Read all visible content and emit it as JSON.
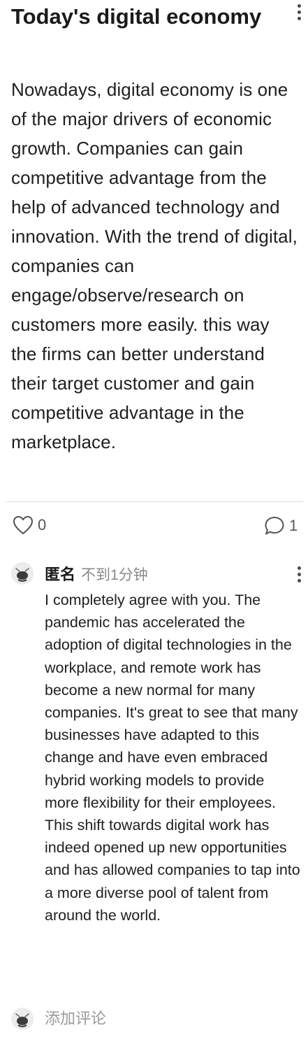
{
  "post": {
    "title": "Today's digital economy",
    "body": "Nowadays, digital economy is one of the major drivers of economic growth. Companies can gain competitive advantage from the help of advanced technology and innovation. With the trend of digital, companies can engage/observe/research on customers more easily. this way the firms can better understand their target customer and gain competitive advantage in the marketplace.",
    "menu_icon": "more-vertical-icon"
  },
  "stats": {
    "likes": "0",
    "like_icon": "heart-outline-icon",
    "comments": "1",
    "comment_icon": "speech-bubble-icon"
  },
  "comment": {
    "author": "匿名",
    "time": "不到1分钟",
    "text": "I completely agree with you. The pandemic has accelerated the adoption of digital technologies in the workplace, and remote work has become a new normal for many companies. It's great to see that many businesses have adapted to this change and have even embraced hybrid working models to provide more flexibility for their employees. This shift towards digital work has indeed opened up new opportunities and has allowed companies to tap into a more diverse pool of talent from around the world.",
    "avatar_icon": "anonymous-avatar-icon",
    "menu_icon": "more-vertical-icon"
  },
  "add_comment": {
    "placeholder": "添加评论"
  },
  "colors": {
    "text": "#1f1f1f",
    "muted": "#8a8a8a",
    "divider": "#dcdcdc"
  }
}
